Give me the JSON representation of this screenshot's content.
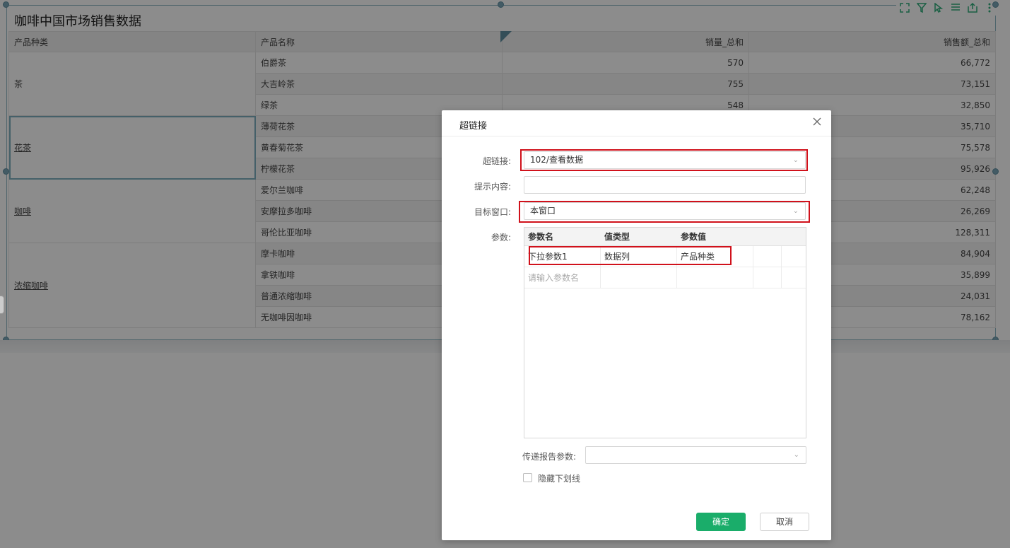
{
  "report": {
    "title": "咖啡中国市场销售数据",
    "columns": [
      "产品种类",
      "产品名称",
      "销量_总和",
      "销售额_总和"
    ],
    "categories": [
      {
        "name": "茶",
        "linked": false,
        "rows": 3
      },
      {
        "name": "花茶",
        "linked": true,
        "rows": 3
      },
      {
        "name": "咖啡",
        "linked": true,
        "rows": 3
      },
      {
        "name": "浓缩咖啡",
        "linked": true,
        "rows": 4
      }
    ],
    "rows": [
      {
        "product": "伯爵茶",
        "qty": "570",
        "sales": "66,772"
      },
      {
        "product": "大吉岭茶",
        "qty": "755",
        "sales": "73,151"
      },
      {
        "product": "绿茶",
        "qty": "548",
        "sales": "32,850"
      },
      {
        "product": "薄荷花茶",
        "qty": "",
        "sales": "35,710"
      },
      {
        "product": "黄春菊花茶",
        "qty": "",
        "sales": "75,578"
      },
      {
        "product": "柠檬花茶",
        "qty": "",
        "sales": "95,926"
      },
      {
        "product": "爱尔兰咖啡",
        "qty": "",
        "sales": "62,248"
      },
      {
        "product": "安摩拉多咖啡",
        "qty": "",
        "sales": "26,269"
      },
      {
        "product": "哥伦比亚咖啡",
        "qty": "",
        "sales": "128,311"
      },
      {
        "product": "摩卡咖啡",
        "qty": "",
        "sales": "84,904"
      },
      {
        "product": "拿铁咖啡",
        "qty": "",
        "sales": "35,899"
      },
      {
        "product": "普通浓缩咖啡",
        "qty": "",
        "sales": "24,031"
      },
      {
        "product": "无咖啡因咖啡",
        "qty": "",
        "sales": "78,162"
      }
    ],
    "toolbar_icons": [
      "fullscreen-icon",
      "filter-icon",
      "pointer-select-icon",
      "list-icon",
      "export-icon",
      "more-icon"
    ]
  },
  "dialog": {
    "title": "超链接",
    "close_icon": "close-icon",
    "hyperlink_label": "超链接:",
    "hyperlink_value": "102/查看数据",
    "tooltip_label": "提示内容:",
    "tooltip_value": "",
    "target_label": "目标窗口:",
    "target_value": "本窗口",
    "params_label": "参数:",
    "params_headers": [
      "参数名",
      "值类型",
      "参数值"
    ],
    "params_rows": [
      {
        "name": "下拉参数1",
        "type": "数据列",
        "value": "产品种类"
      }
    ],
    "params_placeholder": "请输入参数名",
    "pass_params_label": "传递报告参数:",
    "pass_params_value": "",
    "hide_underline_label": "隐藏下划线",
    "hide_underline_checked": false,
    "ok_label": "确定",
    "cancel_label": "取消"
  },
  "colors": {
    "accent_green": "#1aad6a",
    "highlight_red": "#d0111b",
    "panel_border": "#8fb6c4"
  }
}
